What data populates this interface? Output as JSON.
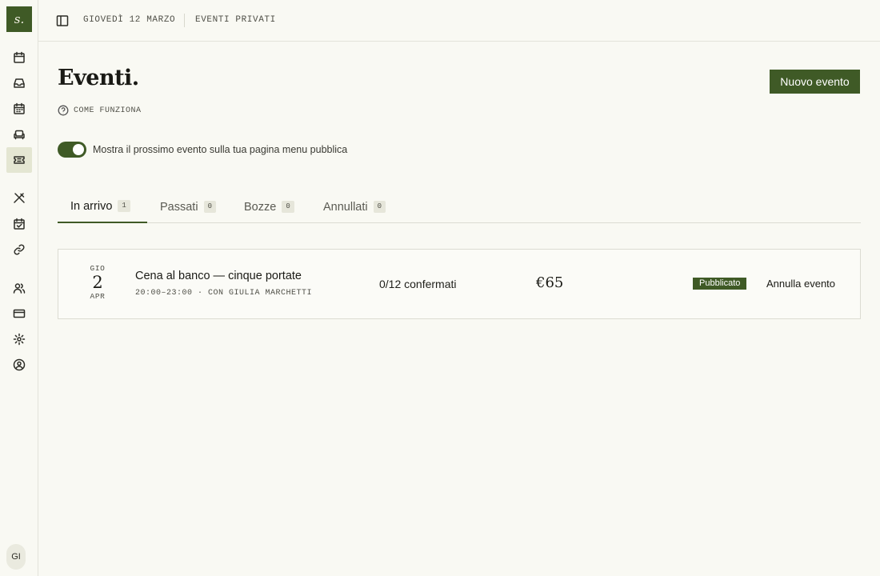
{
  "brand": {
    "logo_text": "s."
  },
  "sidebar": {
    "items": [
      {
        "icon": "calendar-icon"
      },
      {
        "icon": "inbox-icon"
      },
      {
        "icon": "calendar-grid-icon"
      },
      {
        "icon": "sofa-icon"
      },
      {
        "icon": "ticket-icon",
        "active": true
      },
      {
        "icon": "utensils-icon"
      },
      {
        "icon": "calendar-check-icon"
      },
      {
        "icon": "link-icon"
      },
      {
        "icon": "users-icon"
      },
      {
        "icon": "credit-card-icon"
      },
      {
        "icon": "gear-icon"
      },
      {
        "icon": "user-circle-icon"
      }
    ],
    "avatar_initials": "GI"
  },
  "header": {
    "date": "GIOVEDÌ 12 MARZO",
    "section": "EVENTI PRIVATI"
  },
  "page": {
    "title": "Eventi.",
    "help_label": "COME FUNZIONA",
    "new_button": "Nuovo evento",
    "toggle_label": "Mostra il prossimo evento sulla tua pagina menu pubblica",
    "toggle_on": true
  },
  "tabs": [
    {
      "label": "In arrivo",
      "count": "1",
      "active": true
    },
    {
      "label": "Passati",
      "count": "0"
    },
    {
      "label": "Bozze",
      "count": "0"
    },
    {
      "label": "Annullati",
      "count": "0"
    }
  ],
  "events": [
    {
      "dow": "GIO",
      "day": "2",
      "month": "APR",
      "title": "Cena al banco — cinque portate",
      "meta": "20:00–23:00 · CON GIULIA MARCHETTI",
      "confirmed": "0/12 confermati",
      "price": "€65",
      "status": "Pubblicato",
      "cancel_label": "Annulla evento"
    }
  ],
  "colors": {
    "accent": "#3f5a26",
    "background": "#f9f9f3"
  }
}
